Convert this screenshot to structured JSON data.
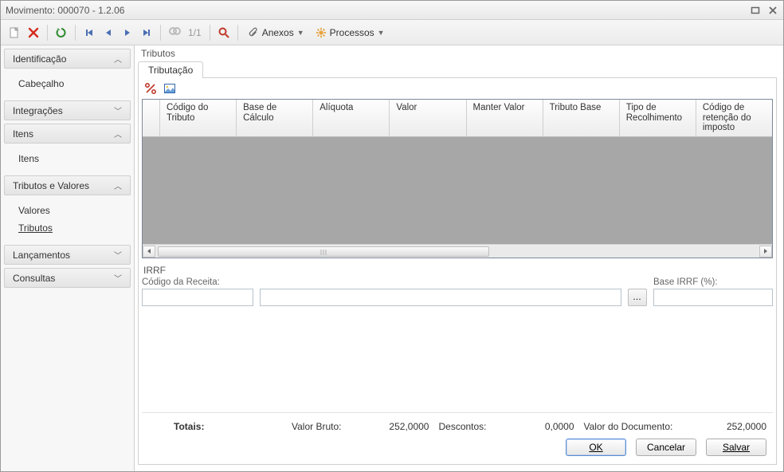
{
  "window": {
    "title": "Movimento: 000070 - 1.2.06"
  },
  "toolbar": {
    "pager": "1/1",
    "anexos_label": "Anexos",
    "processos_label": "Processos"
  },
  "sidebar": {
    "groups": [
      {
        "title": "Identificação",
        "expanded": true,
        "items": [
          {
            "label": "Cabeçalho",
            "active": false
          }
        ]
      },
      {
        "title": "Integrações",
        "expanded": false,
        "items": []
      },
      {
        "title": "Itens",
        "expanded": true,
        "items": [
          {
            "label": "Itens",
            "active": false
          }
        ]
      },
      {
        "title": "Tributos e Valores",
        "expanded": true,
        "items": [
          {
            "label": "Valores",
            "active": false
          },
          {
            "label": "Tributos",
            "active": true
          }
        ]
      },
      {
        "title": "Lançamentos",
        "expanded": false,
        "items": []
      },
      {
        "title": "Consultas",
        "expanded": false,
        "items": []
      }
    ]
  },
  "content": {
    "crumb": "Tributos",
    "tab_label": "Tributação",
    "grid": {
      "columns": [
        "Código do Tributo",
        "Base de Cálculo",
        "Alíquota",
        "Valor",
        "Manter Valor",
        "Tributo Base",
        "Tipo de Recolhimento",
        "Código de retenção do imposto"
      ],
      "rows": []
    },
    "irrf": {
      "section": "IRRF",
      "codigo_label": "Código da Receita:",
      "codigo_value": "",
      "lookup_value": "",
      "base_label": "Base IRRF (%):",
      "base_value": ""
    }
  },
  "footer": {
    "totais_label": "Totais:",
    "valor_bruto_label": "Valor Bruto:",
    "valor_bruto_value": "252,0000",
    "descontos_label": "Descontos:",
    "descontos_value": "0,0000",
    "valor_doc_label": "Valor do Documento:",
    "valor_doc_value": "252,0000",
    "ok": "OK",
    "cancel": "Cancelar",
    "save": "Salvar"
  }
}
